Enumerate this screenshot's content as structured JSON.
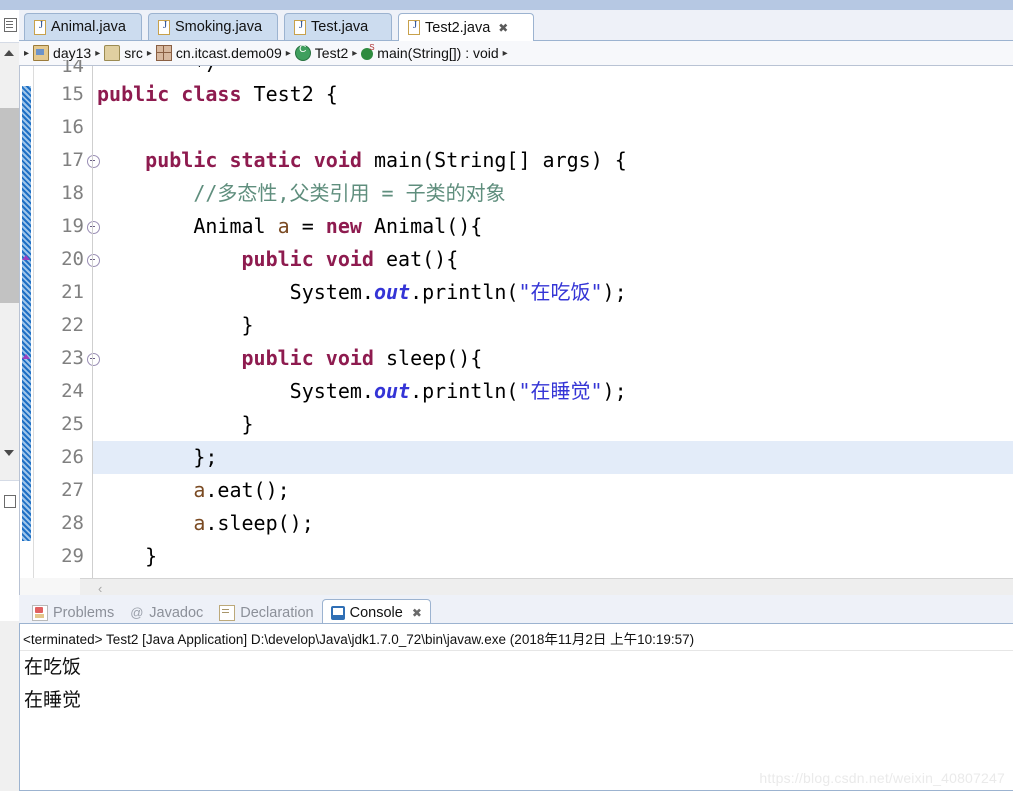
{
  "window": {
    "watermark": "https://blog.csdn.net/weixin_40807247"
  },
  "editor_tabs": [
    {
      "label": "Animal.java",
      "icon": "java-file-icon",
      "active": false,
      "closable": false
    },
    {
      "label": "Smoking.java",
      "icon": "java-file-icon",
      "active": false,
      "closable": false
    },
    {
      "label": "Test.java",
      "icon": "java-file-icon",
      "active": false,
      "closable": false
    },
    {
      "label": "Test2.java",
      "icon": "java-file-icon",
      "active": true,
      "closable": true,
      "close_glyph": "✖"
    }
  ],
  "breadcrumb": {
    "lead_arrow": "▸",
    "separator": "▸",
    "items": [
      {
        "label": "day13",
        "icon": "project-icon"
      },
      {
        "label": "src",
        "icon": "source-folder-icon"
      },
      {
        "label": "cn.itcast.demo09",
        "icon": "package-icon"
      },
      {
        "label": "Test2",
        "icon": "class-icon"
      },
      {
        "label": "main(String[]) : void",
        "icon": "method-static-icon"
      }
    ]
  },
  "code": {
    "partial_top_line": "*/",
    "lines": [
      {
        "no": "15",
        "fold": false,
        "override": false,
        "highlight": false,
        "tokens": [
          {
            "t": "public",
            "c": "kw"
          },
          {
            "t": " ",
            "c": ""
          },
          {
            "t": "class",
            "c": "kw"
          },
          {
            "t": " Test2 {",
            "c": ""
          }
        ]
      },
      {
        "no": "16",
        "fold": false,
        "override": false,
        "highlight": false,
        "tokens": [
          {
            "t": "",
            "c": ""
          }
        ]
      },
      {
        "no": "17",
        "fold": true,
        "override": false,
        "highlight": false,
        "tokens": [
          {
            "t": "    ",
            "c": ""
          },
          {
            "t": "public",
            "c": "kw"
          },
          {
            "t": " ",
            "c": ""
          },
          {
            "t": "static",
            "c": "kw"
          },
          {
            "t": " ",
            "c": ""
          },
          {
            "t": "void",
            "c": "kw"
          },
          {
            "t": " main(String[] args) {",
            "c": ""
          }
        ]
      },
      {
        "no": "18",
        "fold": false,
        "override": false,
        "highlight": false,
        "tokens": [
          {
            "t": "        ",
            "c": ""
          },
          {
            "t": "//多态性,父类引用 = 子类的对象",
            "c": "cm"
          }
        ]
      },
      {
        "no": "19",
        "fold": true,
        "override": false,
        "highlight": false,
        "tokens": [
          {
            "t": "        Animal ",
            "c": ""
          },
          {
            "t": "a",
            "c": "loc"
          },
          {
            "t": " = ",
            "c": ""
          },
          {
            "t": "new",
            "c": "kw"
          },
          {
            "t": " Animal(){",
            "c": ""
          }
        ]
      },
      {
        "no": "20",
        "fold": true,
        "override": true,
        "highlight": false,
        "tokens": [
          {
            "t": "            ",
            "c": ""
          },
          {
            "t": "public",
            "c": "kw"
          },
          {
            "t": " ",
            "c": ""
          },
          {
            "t": "void",
            "c": "kw"
          },
          {
            "t": " eat(){",
            "c": ""
          }
        ]
      },
      {
        "no": "21",
        "fold": false,
        "override": false,
        "highlight": false,
        "tokens": [
          {
            "t": "                System.",
            "c": ""
          },
          {
            "t": "out",
            "c": "fld"
          },
          {
            "t": ".println(",
            "c": ""
          },
          {
            "t": "\"在吃饭\"",
            "c": "str"
          },
          {
            "t": ");",
            "c": ""
          }
        ]
      },
      {
        "no": "22",
        "fold": false,
        "override": false,
        "highlight": false,
        "tokens": [
          {
            "t": "            }",
            "c": ""
          }
        ]
      },
      {
        "no": "23",
        "fold": true,
        "override": true,
        "highlight": false,
        "tokens": [
          {
            "t": "            ",
            "c": ""
          },
          {
            "t": "public",
            "c": "kw"
          },
          {
            "t": " ",
            "c": ""
          },
          {
            "t": "void",
            "c": "kw"
          },
          {
            "t": " sleep(){",
            "c": ""
          }
        ]
      },
      {
        "no": "24",
        "fold": false,
        "override": false,
        "highlight": false,
        "tokens": [
          {
            "t": "                System.",
            "c": ""
          },
          {
            "t": "out",
            "c": "fld"
          },
          {
            "t": ".println(",
            "c": ""
          },
          {
            "t": "\"在睡觉\"",
            "c": "str"
          },
          {
            "t": ");",
            "c": ""
          }
        ]
      },
      {
        "no": "25",
        "fold": false,
        "override": false,
        "highlight": false,
        "tokens": [
          {
            "t": "            }",
            "c": ""
          }
        ]
      },
      {
        "no": "26",
        "fold": false,
        "override": false,
        "highlight": true,
        "tokens": [
          {
            "t": "        };",
            "c": ""
          }
        ]
      },
      {
        "no": "27",
        "fold": false,
        "override": false,
        "highlight": false,
        "tokens": [
          {
            "t": "        ",
            "c": ""
          },
          {
            "t": "a",
            "c": "loc"
          },
          {
            "t": ".eat();",
            "c": ""
          }
        ]
      },
      {
        "no": "28",
        "fold": false,
        "override": false,
        "highlight": false,
        "tokens": [
          {
            "t": "        ",
            "c": ""
          },
          {
            "t": "a",
            "c": "loc"
          },
          {
            "t": ".sleep();",
            "c": ""
          }
        ]
      },
      {
        "no": "29",
        "fold": false,
        "override": false,
        "highlight": false,
        "tokens": [
          {
            "t": "    }",
            "c": ""
          }
        ]
      }
    ]
  },
  "scrollbar": {
    "left_chevron": "‹"
  },
  "bottom_tabs": [
    {
      "label": "Problems",
      "icon": "problems-icon",
      "active": false,
      "closable": false
    },
    {
      "label": "Javadoc",
      "icon": "javadoc-at-icon",
      "active": false,
      "closable": false
    },
    {
      "label": "Declaration",
      "icon": "declaration-icon",
      "active": false,
      "closable": false
    },
    {
      "label": "Console",
      "icon": "console-icon",
      "active": true,
      "closable": true,
      "close_glyph": "✖"
    }
  ],
  "console": {
    "terminated_line": "<terminated> Test2 [Java Application] D:\\develop\\Java\\jdk1.7.0_72\\bin\\javaw.exe (2018年11月2日 上午10:19:57)",
    "output": [
      "在吃饭",
      "在睡觉"
    ]
  },
  "colors": {
    "keyword": "#8e1b4f",
    "string": "#3434d6",
    "comment": "#5f8e7d",
    "field": "#3434d6",
    "local_var": "#7a4a22",
    "current_line": "#e3ecf9",
    "tab_inactive": "#ccdcef",
    "change_bar": "#1e6fc4"
  }
}
